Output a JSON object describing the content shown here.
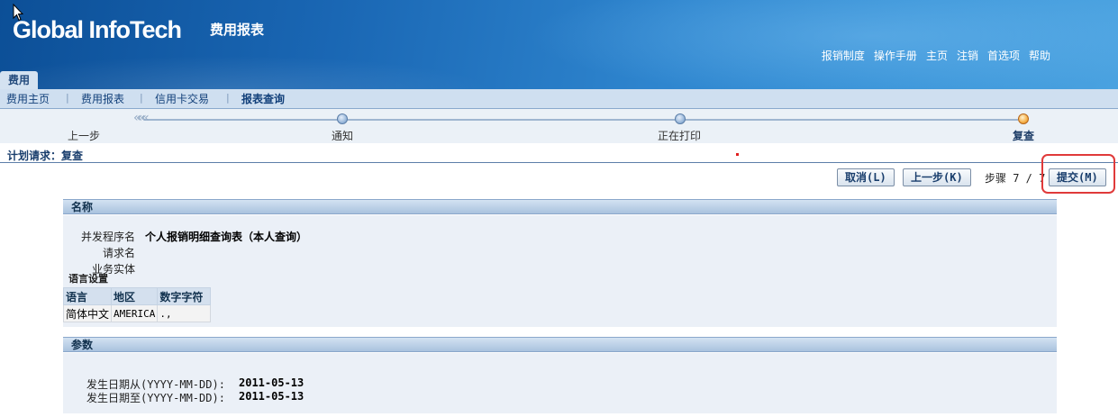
{
  "header": {
    "logo": "Global InfoTech",
    "app_title": "费用报表",
    "global_links": [
      "报销制度",
      "操作手册",
      "主页",
      "注销",
      "首选项",
      "帮助"
    ]
  },
  "tab": {
    "label": "费用"
  },
  "subnav": {
    "items": [
      "费用主页",
      "费用报表",
      "信用卡交易",
      "报表查询"
    ],
    "selected": "报表查询"
  },
  "train": {
    "back_label": "上一步",
    "steps": [
      {
        "label": "通知",
        "state": "visited"
      },
      {
        "label": "正在打印",
        "state": "visited"
      },
      {
        "label": "复查",
        "state": "current"
      }
    ]
  },
  "page_title": "计划请求：复查",
  "actions": {
    "cancel": "取消(L)",
    "back": "上一步(K)",
    "step_indicator": "步骤 7 / 7",
    "submit": "提交(M)"
  },
  "name_section": {
    "header": "名称",
    "fields": [
      {
        "label": "并发程序名",
        "value": "个人报销明细查询表（本人查询）"
      },
      {
        "label": "请求名",
        "value": ""
      },
      {
        "label": "业务实体",
        "value": ""
      }
    ],
    "lang_settings_label": "语言设置",
    "lang_table": {
      "columns": [
        "语言",
        "地区",
        "数字字符"
      ],
      "rows": [
        [
          "简体中文",
          "AMERICA",
          ".,"
        ]
      ]
    }
  },
  "params_section": {
    "header": "参数",
    "fields": [
      {
        "label": "发生日期从(YYYY-MM-DD):",
        "value": "2011-05-13"
      },
      {
        "label": "发生日期至(YYYY-MM-DD):",
        "value": "2011-05-13"
      }
    ]
  },
  "colors": {
    "header_blue": "#1a67b4",
    "nav_bg": "#cfdff0",
    "section_bg": "#ebf0f7",
    "highlight_red": "#e03a3a",
    "current_step": "#f5b049"
  }
}
